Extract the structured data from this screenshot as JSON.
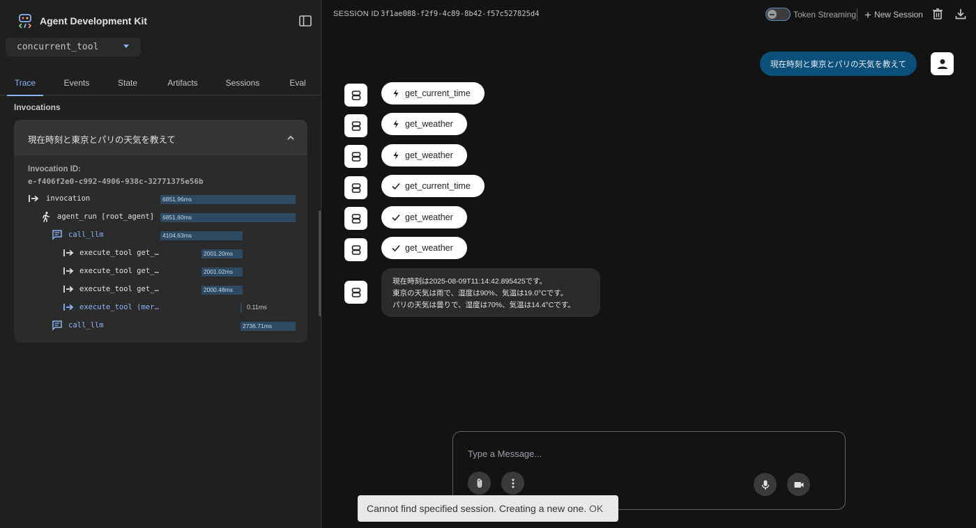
{
  "sidebar": {
    "brand_title": "Agent Development Kit",
    "app_selector": {
      "value": "concurrent_tool"
    },
    "tabs": [
      {
        "label": "Trace",
        "active": true
      },
      {
        "label": "Events",
        "active": false
      },
      {
        "label": "State",
        "active": false
      },
      {
        "label": "Artifacts",
        "active": false
      },
      {
        "label": "Sessions",
        "active": false
      },
      {
        "label": "Eval",
        "active": false
      }
    ],
    "invocations_title": "Invocations",
    "invocation": {
      "title": "現在時刻と東京とパリの天気を教えて",
      "id_label": "Invocation ID:",
      "id_value": "e-f406f2e0-c992-4906-938c-32771375e56b",
      "spans": [
        {
          "label": "invocation",
          "duration": "6851.96ms",
          "icon": "arrow-right-bar-icon"
        },
        {
          "label": "agent_run [root_agent]",
          "duration": "6851.60ms",
          "icon": "running-person-icon"
        },
        {
          "label": "call_llm",
          "duration": "4104.63ms",
          "icon": "chat-bubble-icon"
        },
        {
          "label": "execute_tool get_…",
          "duration": "2001.20ms",
          "icon": "arrow-right-bar-icon"
        },
        {
          "label": "execute_tool get_…",
          "duration": "2001.02ms",
          "icon": "arrow-right-bar-icon"
        },
        {
          "label": "execute_tool get_…",
          "duration": "2000.48ms",
          "icon": "arrow-right-bar-icon"
        },
        {
          "label": "execute_tool (mer…",
          "duration": "0.11ms",
          "icon": "arrow-right-bar-icon"
        },
        {
          "label": "call_llm",
          "duration": "2736.71ms",
          "icon": "chat-bubble-icon"
        }
      ]
    }
  },
  "header": {
    "session_label": "SESSION ID",
    "session_id": "3f1ae088-f2f9-4c89-8b42-f57c527825d4",
    "token_streaming_label": "Token Streaming",
    "token_streaming_on": false,
    "new_session_label": "New Session",
    "icons": [
      "delete-icon",
      "download-icon"
    ]
  },
  "chat": {
    "user_message": "現在時刻と東京とパリの天気を教えて",
    "tool_events": [
      {
        "name": "get_current_time",
        "status": "call",
        "icon": "bolt-icon"
      },
      {
        "name": "get_weather",
        "status": "call",
        "icon": "bolt-icon"
      },
      {
        "name": "get_weather",
        "status": "call",
        "icon": "bolt-icon"
      },
      {
        "name": "get_current_time",
        "status": "response",
        "icon": "check-icon"
      },
      {
        "name": "get_weather",
        "status": "response",
        "icon": "check-icon"
      },
      {
        "name": "get_weather",
        "status": "response",
        "icon": "check-icon"
      }
    ],
    "agent_reply": [
      "現在時刻は2025-08-09T11:14:42.895425です。",
      "東京の天気は雨で、湿度は90%、気温は19.0°Cです。",
      "パリの天気は曇りで、湿度は70%、気温は14.4°Cです。"
    ]
  },
  "composer": {
    "placeholder": "Type a Message...",
    "value": ""
  },
  "snackbar": {
    "message": "Cannot find specified session. Creating a new one.",
    "action": "OK"
  },
  "colors": {
    "accent": "#8ab4f8",
    "user_bubble": "#0b4f7a",
    "trace_bar": "#2e4a63",
    "sidebar_bg": "#1f1f1f",
    "main_bg": "#131314"
  }
}
